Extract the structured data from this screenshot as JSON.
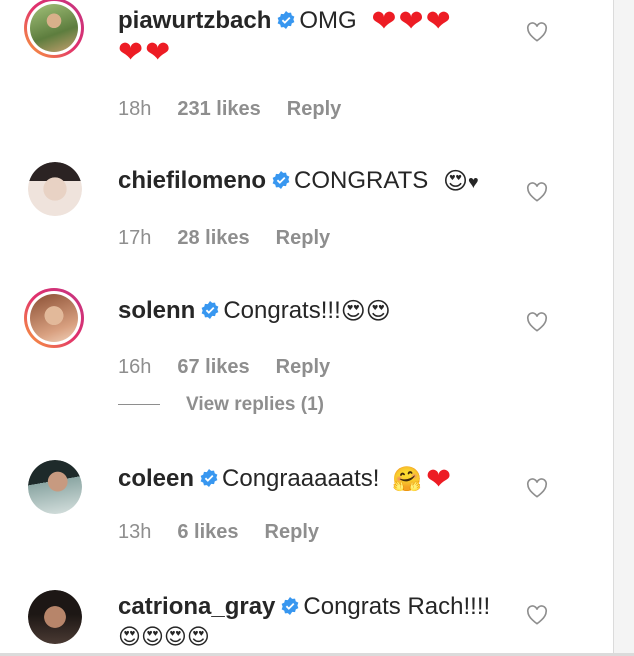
{
  "comments": [
    {
      "username": "piawurtzbach",
      "text": "OMG",
      "emojis_inline": [
        "❤",
        "❤",
        "❤"
      ],
      "emojis_second_line": [
        "❤",
        "❤"
      ],
      "time": "18h",
      "likes": "231 likes",
      "reply": "Reply",
      "avatar_color": "#7a9a5a"
    },
    {
      "username": "chiefilomeno",
      "text": "CONGRATS",
      "emojis_inline": [
        "😍",
        "♥"
      ],
      "time": "17h",
      "likes": "28 likes",
      "reply": "Reply",
      "avatar_color": "#c9b8ad"
    },
    {
      "username": "solenn",
      "text": "Congrats!!!",
      "emojis_inline": [
        "😍",
        "😍"
      ],
      "time": "16h",
      "likes": "67 likes",
      "reply": "Reply",
      "view_replies": "View replies (1)",
      "avatar_color": "#b07a5e"
    },
    {
      "username": "coleen",
      "text": "Congraaaaats!",
      "emojis_inline": [
        "🤗",
        "❤"
      ],
      "time": "13h",
      "likes": "6 likes",
      "reply": "Reply",
      "avatar_color": "#6f8a86"
    },
    {
      "username": "catriona_gray",
      "text": "Congrats Rach!!!!",
      "emojis_second_line": [
        "😍",
        "😍",
        "😍",
        "😍"
      ],
      "avatar_color": "#3a2e2a"
    }
  ],
  "colors": {
    "verified_blue": "#3897f0",
    "heart_red": "#ed1c24",
    "meta_gray": "#8e8e8e",
    "text": "#262626"
  },
  "icons": {
    "verified": "verified-badge-icon",
    "like": "heart-outline-icon"
  }
}
